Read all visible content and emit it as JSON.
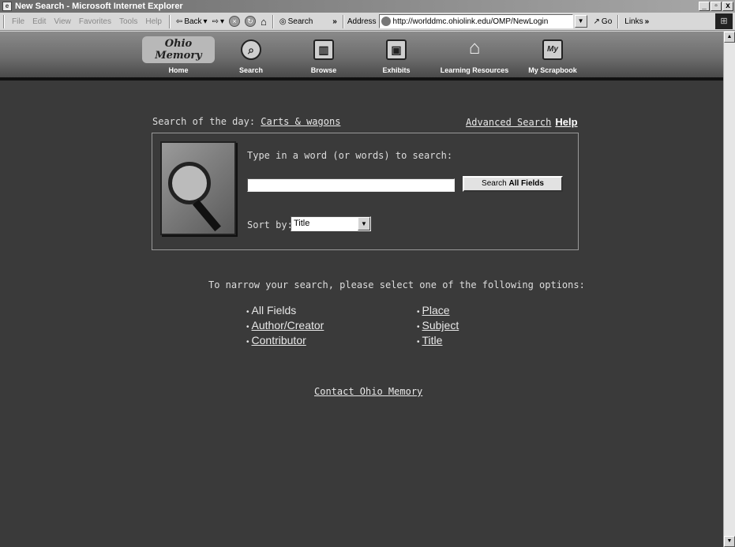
{
  "window": {
    "title": "New Search - Microsoft Internet Explorer",
    "min": "_",
    "max": " ",
    "close": "x"
  },
  "menu": [
    "File",
    "Edit",
    "View",
    "Favorites",
    "Tools",
    "Help"
  ],
  "toolbar": {
    "back": "Back",
    "search": "Search",
    "more": "»",
    "address_label": "Address",
    "address_value": "http://worlddmc.ohiolink.edu/OMP/NewLogin",
    "go": "Go",
    "links": "Links",
    "links_more": "»"
  },
  "site": {
    "logo": "Ohio Memory",
    "nav": [
      {
        "label": "Home",
        "icon": "ohio-memory-logo-icon"
      },
      {
        "label": "Search",
        "icon": "magnifier-icon"
      },
      {
        "label": "Browse",
        "icon": "book-icon"
      },
      {
        "label": "Exhibits",
        "icon": "display-icon"
      },
      {
        "label": "Learning Resources",
        "icon": "schoolhouse-icon"
      },
      {
        "label": "My Scrapbook",
        "icon": "scrapbook-icon"
      }
    ]
  },
  "search": {
    "sotd_prefix": "Search of the day:",
    "sotd_link": "Carts & wagons",
    "advanced": "Advanced Search",
    "help": "Help",
    "prompt": "Type in a word (or words) to search:",
    "input_value": "",
    "button_prefix": "Search",
    "button_bold": "All Fields",
    "sort_label": "Sort by:",
    "sort_value": "Title"
  },
  "narrow": {
    "text": "To narrow your search, please select one of the following options:",
    "col1": [
      "All Fields",
      "Author/Creator",
      "Contributor"
    ],
    "col2": [
      "Place",
      "Subject",
      "Title"
    ]
  },
  "contact": "Contact Ohio Memory"
}
